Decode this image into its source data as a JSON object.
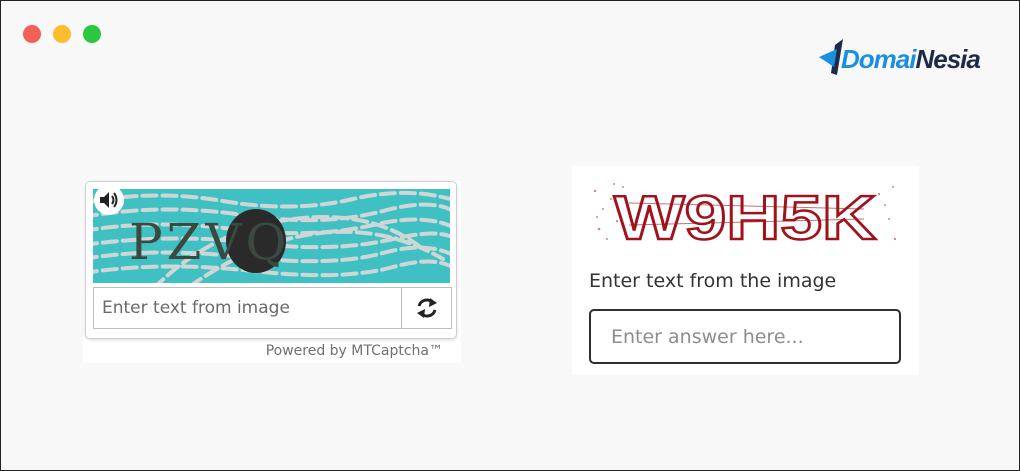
{
  "window": {
    "controls": [
      {
        "name": "close",
        "color": "#f45f58"
      },
      {
        "name": "minimize",
        "color": "#fbbc2d"
      },
      {
        "name": "maximize",
        "color": "#2ac840"
      }
    ]
  },
  "brand": {
    "name_prefix": "DomaiNesia",
    "name_part1": "Domai",
    "name_part2": "Nesia",
    "color_part1": "#1a8fe0",
    "color_part2": "#1d2a4a"
  },
  "mtcaptcha": {
    "captcha_text": "PZVQ",
    "audio_icon": "speaker-icon",
    "input_placeholder": "Enter text from image",
    "refresh_icon": "refresh-icon",
    "powered_by": "Powered by MTCaptcha™",
    "bg_color": "#3fc1c4"
  },
  "text_captcha": {
    "captcha_text": "W9H5K",
    "label": "Enter text from the image",
    "input_placeholder": "Enter answer here...",
    "captcha_color": "#a0121c"
  }
}
